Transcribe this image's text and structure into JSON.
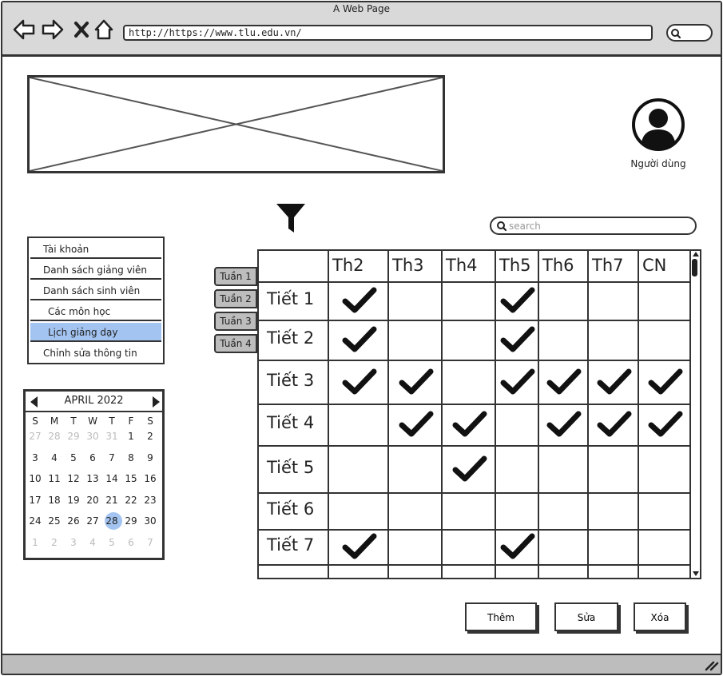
{
  "window": {
    "title": "A Web Page",
    "url": "http://https://www.tlu.edu.vn/"
  },
  "user": {
    "label": "Người dùng"
  },
  "search": {
    "placeholder": "search"
  },
  "menu": {
    "items": [
      "Tài khoản",
      "Danh sách giảng viên",
      "Danh sách sinh viên",
      "Các môn học",
      "Lịch giảng dạy",
      "Chỉnh sửa thông tin"
    ],
    "active": "Lịch giảng dạy"
  },
  "calendar": {
    "month": "APRIL 2022",
    "weekdays": [
      "S",
      "M",
      "T",
      "W",
      "T",
      "F",
      "S"
    ],
    "weeks": [
      [
        "27",
        "28",
        "29",
        "30",
        "31",
        "1",
        "2"
      ],
      [
        "3",
        "4",
        "5",
        "6",
        "7",
        "8",
        "9"
      ],
      [
        "10",
        "11",
        "12",
        "13",
        "14",
        "15",
        "16"
      ],
      [
        "17",
        "18",
        "19",
        "20",
        "21",
        "22",
        "23"
      ],
      [
        "24",
        "25",
        "26",
        "27",
        "28",
        "29",
        "30"
      ],
      [
        "1",
        "2",
        "3",
        "4",
        "5",
        "6",
        "7"
      ]
    ],
    "selected": "28"
  },
  "week_tabs": [
    "Tuần 1",
    "Tuần 2",
    "Tuần 3",
    "Tuần 4"
  ],
  "schedule": {
    "days": [
      "Th2",
      "Th3",
      "Th4",
      "Th5",
      "Th6",
      "Th7",
      "CN"
    ],
    "periods": [
      "Tiết 1",
      "Tiết 2",
      "Tiết 3",
      "Tiết 4",
      "Tiết 5",
      "Tiết 6",
      "Tiết 7"
    ],
    "checked": [
      [
        true,
        false,
        false,
        true,
        false,
        false,
        false
      ],
      [
        true,
        false,
        false,
        true,
        false,
        false,
        false
      ],
      [
        true,
        true,
        false,
        true,
        true,
        true,
        true
      ],
      [
        false,
        true,
        true,
        false,
        true,
        true,
        true
      ],
      [
        false,
        false,
        true,
        false,
        false,
        false,
        false
      ],
      [
        false,
        false,
        false,
        false,
        false,
        false,
        false
      ],
      [
        true,
        false,
        false,
        true,
        false,
        false,
        false
      ]
    ]
  },
  "buttons": {
    "add": "Thêm",
    "edit": "Sửa",
    "delete": "Xóa"
  },
  "icons": [
    "back-arrow-icon",
    "forward-arrow-icon",
    "close-icon",
    "home-icon",
    "search-icon",
    "user-avatar-icon",
    "filter-icon",
    "checkmark-icon"
  ],
  "colors": {
    "highlight": "#a3c4f0",
    "chrome": "#d9d9d9"
  }
}
